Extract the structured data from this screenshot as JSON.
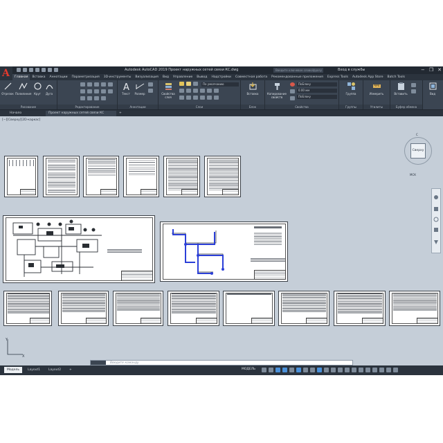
{
  "titlebar": {
    "app_title": "Autodesk AutoCAD 2019   Проект наружных сетей связи КС.dwg",
    "search_placeholder": "Введите ключевое слово/фразу",
    "sign_in": "Вход в службы",
    "logo": "A"
  },
  "menu_tabs": [
    "Главная",
    "Вставка",
    "Аннотации",
    "Параметризация",
    "3D-инструменты",
    "Визуализация",
    "Вид",
    "Управление",
    "Вывод",
    "Надстройки",
    "Совместная работа",
    "Рекомендованные приложения",
    "Express Tools",
    "Autodesk App Store",
    "Batch Tools"
  ],
  "ribbon": {
    "draw": {
      "title": "Рисование",
      "buttons": [
        "Отрезок",
        "Полилиния",
        "Круг",
        "Дуга"
      ]
    },
    "modify": {
      "title": "Редактирование"
    },
    "annotation": {
      "title": "Аннотации",
      "buttons": [
        "Текст",
        "Размер"
      ]
    },
    "layers": {
      "title": "Слои",
      "buttons": [
        "Свойства слоя"
      ],
      "layer_value": "По умолчанию"
    },
    "block": {
      "title": "Блок",
      "buttons": [
        "Вставка"
      ]
    },
    "properties": {
      "title": "Свойства",
      "buttons": [
        "Копирование свойств"
      ],
      "values": [
        "ПоБлоку",
        "0.00 мм",
        "ПоБлоку"
      ]
    },
    "groups": {
      "title": "Группы",
      "buttons": [
        "Группа"
      ]
    },
    "utilities": {
      "title": "Утилиты",
      "buttons": [
        "Измерить"
      ]
    },
    "clipboard": {
      "title": "Буфер обмена",
      "buttons": [
        "Вставить"
      ]
    },
    "view": {
      "buttons": [
        "Вид"
      ]
    }
  },
  "file_tabs": [
    "Начало",
    "Проект наружных сетей связи КС"
  ],
  "drawing": {
    "view_label": "[−][Сверху][2D-каркас]",
    "viewcube": {
      "face": "Сверху",
      "north": "С",
      "wcs": "МСК"
    },
    "ucs": {
      "x": "X",
      "y": "Y"
    }
  },
  "command": {
    "placeholder": "Введите команду"
  },
  "status": {
    "layouts": [
      "Модель",
      "Layout1",
      "Layout2"
    ],
    "model_button": "МОДЕЛЬ"
  }
}
